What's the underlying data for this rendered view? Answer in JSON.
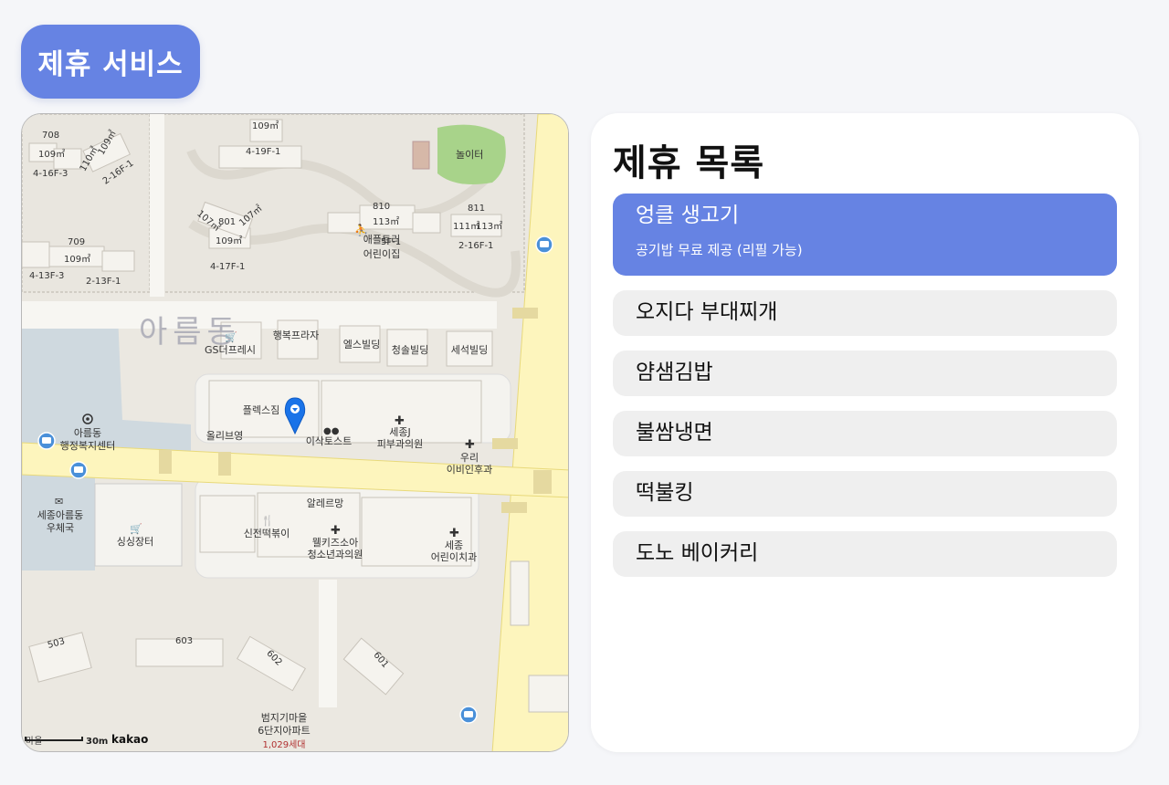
{
  "header": {
    "title": "제휴 서비스"
  },
  "map": {
    "district_label": "아름동",
    "scale_label": "30m",
    "provider_label": "kakao",
    "labels": {
      "n708": "708",
      "n709": "709",
      "n801": "801",
      "n810": "810",
      "n811": "811",
      "n503": "503",
      "n603": "603",
      "n602": "602",
      "n601": "601",
      "a109_1": "109㎡",
      "a109_2": "109㎡",
      "a109_3": "109㎡",
      "a109_4": "109㎡",
      "a109_5": "109㎡",
      "a110": "110㎡",
      "a107_1": "107㎡",
      "a107_2": "107㎡",
      "a113_1": "113㎡",
      "a113_2": "113㎡",
      "a111": "111㎡",
      "f4_16_3": "4-16F-3",
      "f2_16_1a": "2-16F-1",
      "f4_19_1": "4-19F-1",
      "f4_13_3": "4-13F-3",
      "f2_13_1": "2-13F-1",
      "f4_17_1": "4-17F-1",
      "f5_1": "5F-1",
      "f2_16_1b": "2-16F-1",
      "playground": "놀이터",
      "daycare1": "애플트리",
      "daycare2": "어린이집",
      "gs": "GS더프레시",
      "haengbok": "행복프라자",
      "els": "엘스빌딩",
      "cheongsol": "청솔빌딩",
      "seseok": "세석빌딩",
      "flexgym": "플렉스짐",
      "oliveyoung": "올리브영",
      "isaac": "이삭토스트",
      "sejongj1": "세종J",
      "sejongj2": "피부과의원",
      "uri1": "우리",
      "uri2": "이비인후과",
      "areum1": "아름동",
      "areum2": "행정복지센터",
      "post1": "세종아름동",
      "post2": "우체국",
      "singsing": "싱싱장터",
      "alleuremang": "알레르망",
      "sinjeon": "신전떡볶이",
      "wellkids1": "웰키즈소아",
      "wellkids2": "청소년과의원",
      "sejongdent1": "세종",
      "sejongdent2": "어린이치과",
      "beomji1": "범지기마을",
      "beomji2": "6단지아파트",
      "beomji3": "1,029세대",
      "maeul": "마을"
    }
  },
  "panel": {
    "title": "제휴 목록",
    "items": [
      {
        "name": "엉클 생고기",
        "desc": "공기밥 무료 제공 (리필 가능)"
      },
      {
        "name": "오지다 부대찌개"
      },
      {
        "name": "얌샘김밥"
      },
      {
        "name": "불쌈냉면"
      },
      {
        "name": "떡불킹"
      },
      {
        "name": "도노 베이커리"
      }
    ]
  },
  "colors": {
    "accent": "#6683e3",
    "road_major": "#fdf5bd",
    "park": "#a8d38a",
    "water": "#c9d6df",
    "marker": "#1a73e8"
  }
}
